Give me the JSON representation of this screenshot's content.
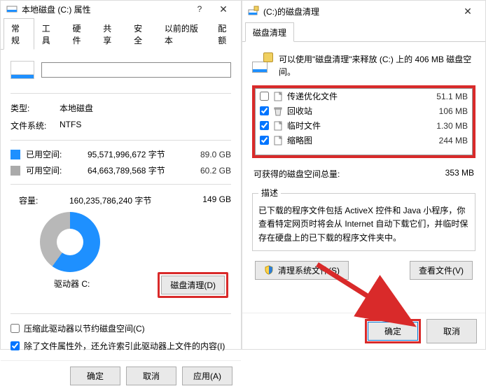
{
  "left": {
    "title": "本地磁盘 (C:) 属性",
    "tabs": [
      "常规",
      "工具",
      "硬件",
      "共享",
      "安全",
      "以前的版本",
      "配额"
    ],
    "type_label": "类型:",
    "type_value": "本地磁盘",
    "fs_label": "文件系统:",
    "fs_value": "NTFS",
    "used_label": "已用空间:",
    "used_bytes": "95,571,996,672 字节",
    "used_human": "89.0 GB",
    "free_label": "可用空间:",
    "free_bytes": "64,663,789,568 字节",
    "free_human": "60.2 GB",
    "cap_label": "容量:",
    "cap_bytes": "160,235,786,240 字节",
    "cap_human": "149 GB",
    "driver_label": "驱动器 C:",
    "cleanup_btn": "磁盘清理(D)",
    "compress_label": "压缩此驱动器以节约磁盘空间(C)",
    "index_label": "除了文件属性外，还允许索引此驱动器上文件的内容(I)",
    "ok": "确定",
    "cancel": "取消",
    "apply": "应用(A)"
  },
  "right": {
    "title": "(C:)的磁盘清理",
    "tab": "磁盘清理",
    "intro": "可以使用\"磁盘清理\"来释放  (C:) 上的 406 MB 磁盘空间。",
    "items": [
      {
        "checked": false,
        "name": "传递优化文件",
        "size": "51.1 MB"
      },
      {
        "checked": true,
        "name": "回收站",
        "size": "106 MB"
      },
      {
        "checked": true,
        "name": "临时文件",
        "size": "1.30 MB"
      },
      {
        "checked": true,
        "name": "缩略图",
        "size": "244 MB"
      }
    ],
    "total_label": "可获得的磁盘空间总量:",
    "total_value": "353 MB",
    "desc_legend": "描述",
    "desc_text": "已下载的程序文件包括 ActiveX 控件和 Java 小程序，你查看特定网页时将会从 Internet 自动下载它们，并临时保存在硬盘上的已下载的程序文件夹中。",
    "clean_sys_btn": "清理系统文件(S)",
    "view_files_btn": "查看文件(V)",
    "ok": "确定",
    "cancel": "取消"
  }
}
